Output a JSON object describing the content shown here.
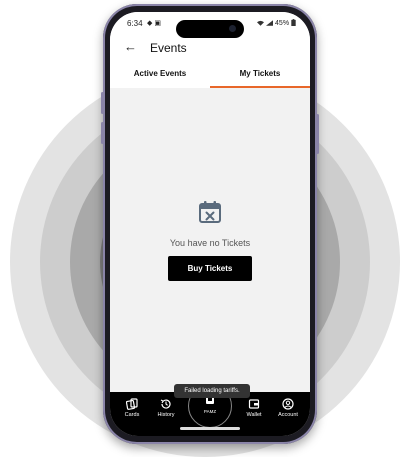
{
  "status_bar": {
    "time": "6:34",
    "left_icons": "◆ ▣",
    "battery": "45%"
  },
  "app_bar": {
    "title": "Events",
    "back_glyph": "←"
  },
  "tabs": [
    {
      "label": "Active Events",
      "active": false
    },
    {
      "label": "My Tickets",
      "active": true
    }
  ],
  "empty_state": {
    "message": "You have no Tickets",
    "button_label": "Buy Tickets"
  },
  "toast": "Failed loading tariffs.",
  "bottom_nav": {
    "items": [
      {
        "label": "Cards",
        "icon": "cards-icon"
      },
      {
        "label": "History",
        "icon": "history-icon"
      },
      {
        "label": "Wallet",
        "icon": "wallet-icon"
      },
      {
        "label": "Account",
        "icon": "account-icon"
      }
    ],
    "center_label": "PAMZ"
  },
  "colors": {
    "accent": "#e8672a",
    "button_bg": "#000000",
    "nav_bg": "#000000"
  }
}
